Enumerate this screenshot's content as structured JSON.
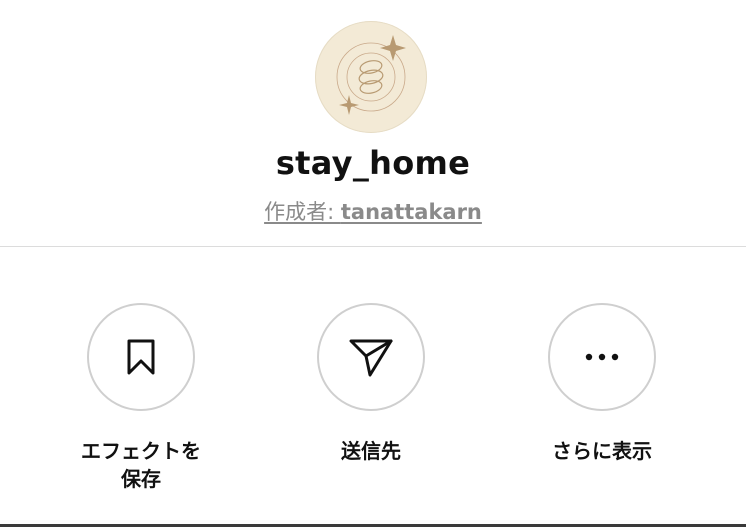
{
  "effect": {
    "name": "stay_home",
    "creator_prefix": "作成者: ",
    "creator_name": "tanattakarn",
    "avatar_bg": "#f3ead6",
    "avatar_accent": "#b89a72"
  },
  "actions": [
    {
      "label_line1": "エフェクトを",
      "label_line2": "保存",
      "icon": "bookmark-icon"
    },
    {
      "label_line1": "送信先",
      "icon": "send-icon"
    },
    {
      "label_line1": "さらに表示",
      "icon": "more-icon"
    }
  ]
}
